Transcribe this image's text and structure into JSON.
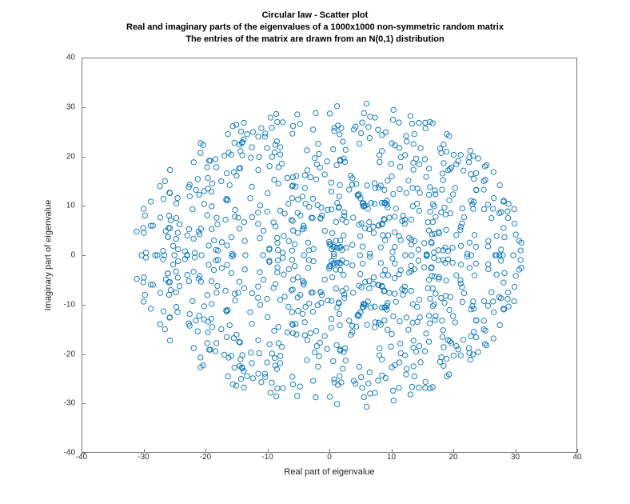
{
  "chart_data": {
    "type": "scatter",
    "title": "Circular law - Scatter plot",
    "subtitle1": "Real and imaginary parts of the eigenvalues of a 1000x1000 non-symmetric random matrix",
    "subtitle2": "The entries of the matrix are drawn from an N(0,1) distribution",
    "xlabel": "Real part of eigenvalue",
    "ylabel": "Imaginary part of eigenvalue",
    "xlim": [
      -40,
      40
    ],
    "ylim": [
      -40,
      40
    ],
    "xticks": [
      -40,
      -30,
      -20,
      -10,
      0,
      10,
      20,
      30,
      40
    ],
    "yticks": [
      -40,
      -30,
      -20,
      -10,
      0,
      10,
      20,
      30,
      40
    ],
    "marker_radius_px": 3.2,
    "marker_stroke": "#0072BD",
    "note": "~1000 eigenvalues approximately uniform inside disc of radius ~31.6 (sqrt(1000)); conjugate-paired (y-symmetric). Points are generated to match this distribution.",
    "n_points": 1000,
    "radius_approx": 31.6
  }
}
